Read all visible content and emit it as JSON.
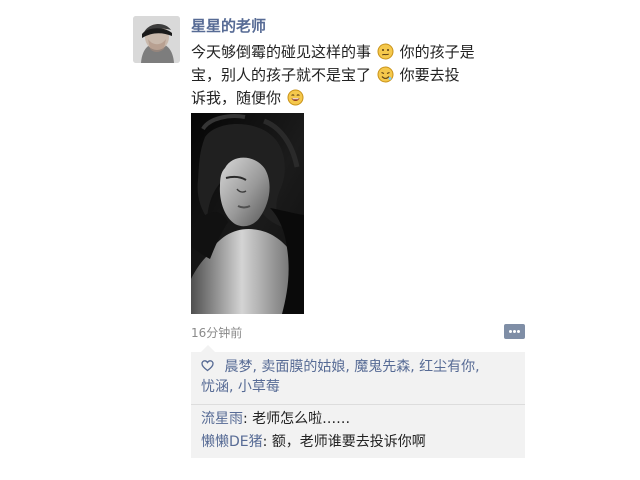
{
  "post": {
    "author": "星星的老师",
    "text_line_1_a": "今天够倒霉的碰见这样的事",
    "text_line_1_b": "你的孩子是",
    "text_line_2_a": "宝，别人的孩子就不是宝了",
    "text_line_2_b": "你要去投",
    "text_line_3_a": "诉我，随便你",
    "time": "16分钟前"
  },
  "likes": {
    "line_1": "晨梦, 卖面膜的姑娘, 魔鬼先森, 红尘有你,",
    "line_2": "忧涵, 小草莓"
  },
  "comments": [
    {
      "author": "流星雨",
      "separator": ": ",
      "text": "老师怎么啦……"
    },
    {
      "author": "懒懒DE猪",
      "separator": ": ",
      "text": "额，老师谁要去投诉你啊"
    }
  ],
  "icons": {
    "emoji_1": "confused-face-icon",
    "emoji_2": "drooling-face-icon",
    "emoji_3": "grinning-face-icon",
    "like": "heart-outline-icon",
    "comment_button": "more-dots-icon"
  },
  "colors": {
    "name_blue": "#576b95",
    "comment_button": "#7f8ea6",
    "interaction_background": "#f2f2f2",
    "time_gray": "#8a8a8a"
  }
}
